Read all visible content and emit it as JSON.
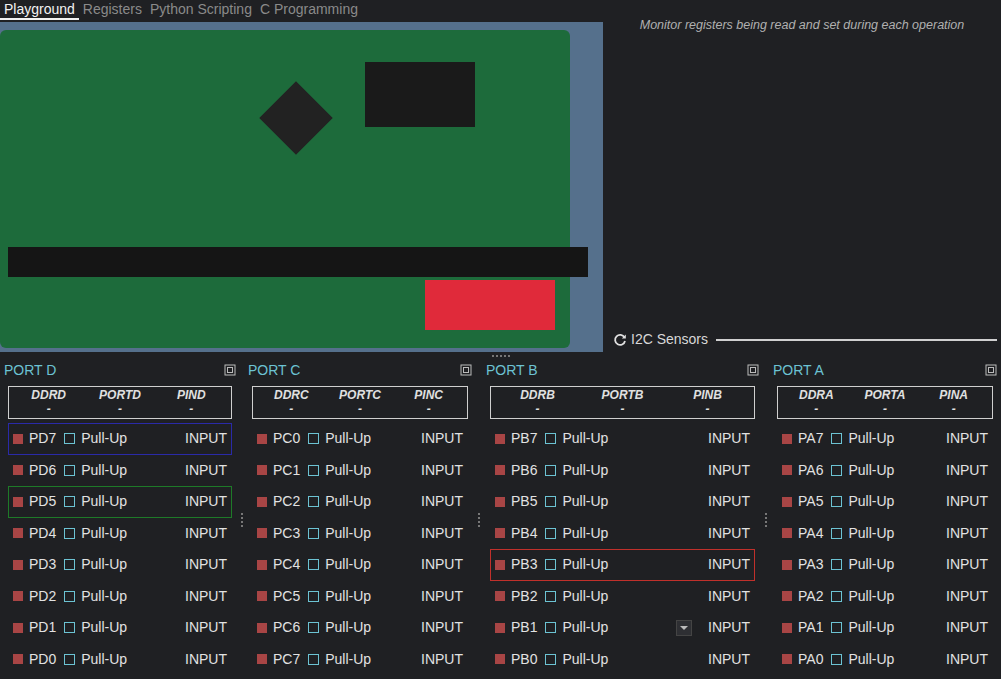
{
  "tabs": [
    {
      "label": "Playground",
      "selected": true
    },
    {
      "label": "Registers",
      "selected": false
    },
    {
      "label": "Python Scripting",
      "selected": false
    },
    {
      "label": "C Programming",
      "selected": false
    }
  ],
  "hint": "Monitor registers being read and set during each operation",
  "i2c": {
    "label": "I2C Sensors"
  },
  "ports": [
    {
      "title": "PORT D",
      "headers": [
        "DDRD",
        "PORTD",
        "PIND"
      ],
      "values": [
        "-",
        "-",
        "-"
      ],
      "pins": [
        {
          "name": "PD7",
          "output": false,
          "pull_up": false,
          "label": "Pull-Up",
          "state": "INPUT",
          "kind": "plain",
          "color": "#2a2aa8"
        },
        {
          "name": "PD6",
          "output": false,
          "pull_up": false,
          "label": "Pull-Up",
          "state": "INPUT",
          "kind": "plain"
        },
        {
          "name": "PD5",
          "output": false,
          "pull_up": false,
          "label": "Pull-Up",
          "state": "INPUT",
          "kind": "plain",
          "color": "#1e7a28"
        },
        {
          "name": "PD4",
          "output": false,
          "pull_up": false,
          "label": "Pull-Up",
          "state": "INPUT",
          "kind": "plain"
        },
        {
          "name": "PD3",
          "output": false,
          "pull_up": false,
          "label": "Pull-Up",
          "state": "INPUT",
          "kind": "plain"
        },
        {
          "name": "PD2",
          "output": false,
          "pull_up": false,
          "label": "Pull-Up",
          "state": "INPUT",
          "kind": "plain"
        },
        {
          "name": "PD1",
          "output": false,
          "pull_up": false,
          "label": "Pull-Up",
          "state": "INPUT",
          "kind": "plain"
        },
        {
          "name": "PD0",
          "output": false,
          "pull_up": false,
          "label": "Pull-Up",
          "state": "INPUT",
          "kind": "plain"
        }
      ]
    },
    {
      "title": "PORT C",
      "headers": [
        "DDRC",
        "PORTC",
        "PINC"
      ],
      "values": [
        "-",
        "-",
        "-"
      ],
      "pins": [
        {
          "name": "PC0",
          "output": false,
          "pull_up": false,
          "label": "Pull-Up",
          "state": "INPUT",
          "kind": "plain"
        },
        {
          "name": "PC1",
          "output": false,
          "pull_up": false,
          "label": "Pull-Up",
          "state": "INPUT",
          "kind": "plain"
        },
        {
          "name": "PC2",
          "output": false,
          "pull_up": false,
          "label": "Pull-Up",
          "state": "INPUT",
          "kind": "plain"
        },
        {
          "name": "PC3",
          "output": false,
          "pull_up": false,
          "label": "Pull-Up",
          "state": "INPUT",
          "kind": "plain"
        },
        {
          "name": "PC4",
          "output": false,
          "pull_up": false,
          "label": "Pull-Up",
          "state": "INPUT",
          "kind": "plain"
        },
        {
          "name": "PC5",
          "output": false,
          "pull_up": false,
          "label": "Pull-Up",
          "state": "INPUT",
          "kind": "plain"
        },
        {
          "name": "PC6",
          "output": false,
          "pull_up": false,
          "label": "Pull-Up",
          "state": "INPUT",
          "kind": "plain"
        },
        {
          "name": "PC7",
          "output": false,
          "pull_up": false,
          "label": "Pull-Up",
          "state": "INPUT",
          "kind": "plain"
        }
      ]
    },
    {
      "title": "PORT B",
      "headers": [
        "DDRB",
        "PORTB",
        "PINB"
      ],
      "values": [
        "-",
        "-",
        "-"
      ],
      "pins": [
        {
          "name": "PB7",
          "output": false,
          "pull_up": false,
          "label": "Pull-Up",
          "state": "INPUT",
          "kind": "plain"
        },
        {
          "name": "PB6",
          "output": false,
          "pull_up": false,
          "label": "Pull-Up",
          "state": "INPUT",
          "kind": "plain"
        },
        {
          "name": "PB5",
          "output": false,
          "pull_up": false,
          "label": "Pull-Up",
          "state": "INPUT",
          "kind": "plain"
        },
        {
          "name": "PB4",
          "output": false,
          "pull_up": false,
          "label": "Pull-Up",
          "state": "INPUT",
          "kind": "plain"
        },
        {
          "name": "PB3",
          "output": false,
          "pull_up": false,
          "label": "Pull-Up",
          "state": "INPUT",
          "kind": "plain",
          "color": "#c0302b"
        },
        {
          "name": "PB2",
          "output": false,
          "pull_up": false,
          "label": "Pull-Up",
          "state": "INPUT",
          "kind": "plain"
        },
        {
          "name": "PB1",
          "output": false,
          "pull_up": false,
          "label": "Pull-Up",
          "state": "INPUT",
          "kind": "dropdown"
        },
        {
          "name": "PB0",
          "output": false,
          "pull_up": false,
          "label": "Pull-Up",
          "state": "INPUT",
          "kind": "plain"
        }
      ]
    },
    {
      "title": "PORT A",
      "headers": [
        "DDRA",
        "PORTA",
        "PINA"
      ],
      "values": [
        "-",
        "-",
        "-"
      ],
      "pins": [
        {
          "name": "PA7",
          "output": false,
          "pull_up": false,
          "label": "Pull-Up",
          "state": "INPUT",
          "kind": "plain"
        },
        {
          "name": "PA6",
          "output": false,
          "pull_up": false,
          "label": "Pull-Up",
          "state": "INPUT",
          "kind": "plain"
        },
        {
          "name": "PA5",
          "output": false,
          "pull_up": false,
          "label": "Pull-Up",
          "state": "INPUT",
          "kind": "plain"
        },
        {
          "name": "PA4",
          "output": false,
          "pull_up": false,
          "label": "Pull-Up",
          "state": "INPUT",
          "kind": "plain"
        },
        {
          "name": "PA3",
          "output": false,
          "pull_up": false,
          "label": "Pull-Up",
          "state": "INPUT",
          "kind": "plain"
        },
        {
          "name": "PA2",
          "output": false,
          "pull_up": false,
          "label": "Pull-Up",
          "state": "INPUT",
          "kind": "plain"
        },
        {
          "name": "PA1",
          "output": false,
          "pull_up": false,
          "label": "Pull-Up",
          "state": "INPUT",
          "kind": "plain"
        },
        {
          "name": "PA0",
          "output": false,
          "pull_up": false,
          "label": "Pull-Up",
          "state": "INPUT",
          "kind": "plain"
        }
      ]
    }
  ]
}
